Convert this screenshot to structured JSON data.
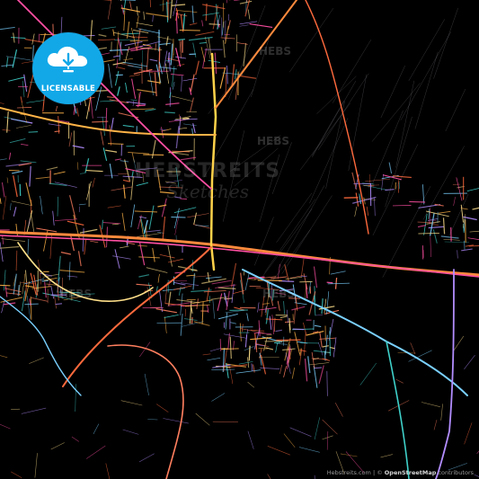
{
  "map": {
    "background": "#000000",
    "road_colors": [
      "#ff6a3d",
      "#ffb347",
      "#ff4fa3",
      "#7ad0ff",
      "#b28dff",
      "#ffe08a",
      "#3fd0c9",
      "#ff7f5f"
    ]
  },
  "badge": {
    "label": "LICENSABLE",
    "icon": "cloud-download-icon",
    "color": "#12a8e8"
  },
  "watermarks": {
    "hebs": "HEBS",
    "center_big": "HEBSTREITS",
    "center_small": "Sketches"
  },
  "credit": {
    "site": "Hebstreits.com",
    "sep1": " | © ",
    "osm": "OpenStreetMap",
    "tail": " contributors"
  }
}
